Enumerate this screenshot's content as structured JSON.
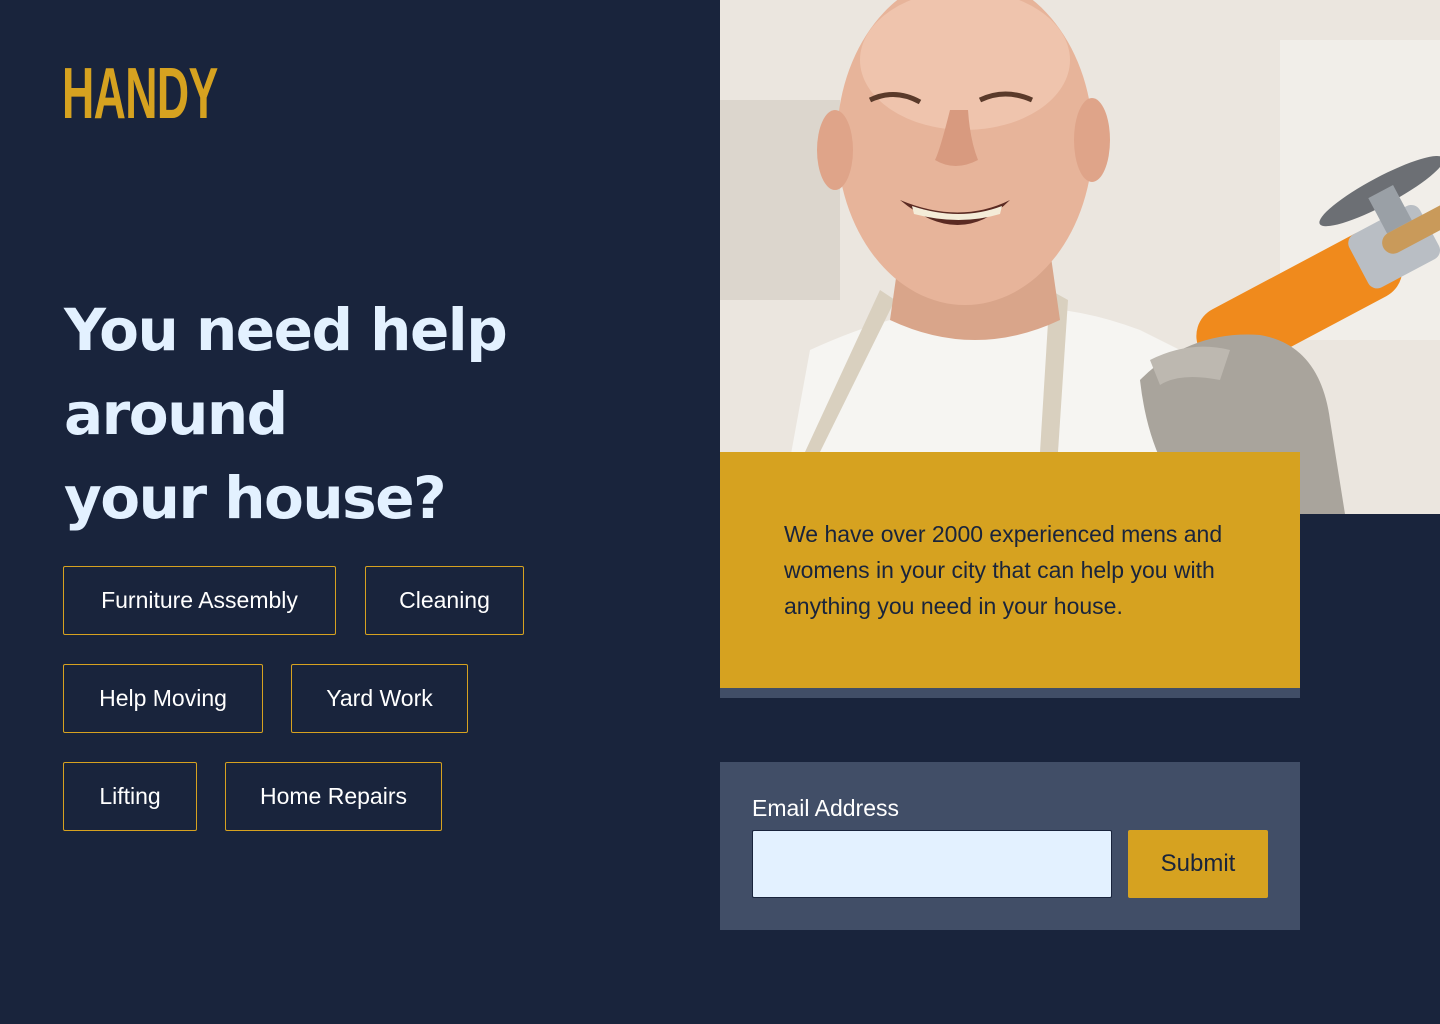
{
  "brand": {
    "logo": "HANDY",
    "accent_color": "#d6a220",
    "background_color": "#19243c"
  },
  "hero": {
    "headline_lines": [
      "You need help",
      "around",
      "your house?"
    ]
  },
  "services": [
    "Furniture Assembly",
    "Cleaning",
    "Help Moving",
    "Yard Work",
    "Lifting",
    "Home Repairs"
  ],
  "photo": {
    "description_icon": "smiling-handyman-with-angle-grinder-photo"
  },
  "info": {
    "text": "We have over 2000 experienced mens and womens in your city that can help you with anything you need in your house."
  },
  "signup": {
    "email_label": "Email Address",
    "email_value": "",
    "email_placeholder": "",
    "submit_label": "Submit"
  }
}
